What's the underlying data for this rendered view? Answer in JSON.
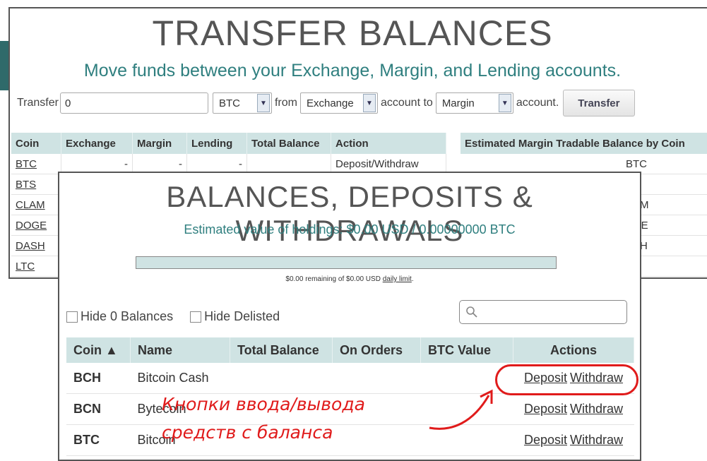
{
  "transfer": {
    "title": "TRANSFER BALANCES",
    "subtitle": "Move funds between your Exchange, Margin, and Lending accounts.",
    "transfer_label": "Transfer",
    "amount_value": "0",
    "currency_selected": "BTC",
    "from_label": "from",
    "from_selected": "Exchange",
    "to_label": "account to",
    "to_selected": "Margin",
    "account_label": "account.",
    "button_label": "Transfer"
  },
  "coin_table": {
    "headers": [
      "Coin",
      "Exchange",
      "Margin",
      "Lending",
      "Total Balance",
      "Action"
    ],
    "rows": [
      {
        "coin": "BTC",
        "exchange": "-",
        "margin": "-",
        "lending": "-",
        "total": "",
        "action": "Deposit/Withdraw"
      },
      {
        "coin": "BTS"
      },
      {
        "coin": "CLAM"
      },
      {
        "coin": "DOGE"
      },
      {
        "coin": "DASH"
      },
      {
        "coin": "LTC"
      }
    ]
  },
  "est_table": {
    "header": "Estimated Margin Tradable Balance by Coin",
    "rows": [
      "BTC",
      "",
      "AM",
      "GE",
      "SH",
      ""
    ]
  },
  "balances": {
    "title": "BALANCES, DEPOSITS & WITHDRAWALS",
    "estimate": "Estimated value of holdings: $0.00 USD / 0.00000000 BTC",
    "limit_fraction": 0,
    "limit_text_before": "$0.00 remaining of $0.00 USD",
    "limit_link": "daily limit",
    "limit_text_after": ".",
    "hide_zero_label": "Hide 0 Balances",
    "hide_delisted_label": "Hide Delisted",
    "headers": [
      "Coin ▲",
      "Name",
      "Total Balance",
      "On Orders",
      "BTC Value",
      "Actions"
    ],
    "rows": [
      {
        "code": "BCH",
        "name": "Bitcoin Cash",
        "deposit": "Deposit",
        "withdraw": "Withdraw"
      },
      {
        "code": "BCN",
        "name": "Bytecoin",
        "deposit": "Deposit",
        "withdraw": "Withdraw"
      },
      {
        "code": "BTC",
        "name": "Bitcoin",
        "deposit": "Deposit",
        "withdraw": "Withdraw"
      }
    ]
  },
  "annotation": {
    "line1": "Кнопки ввода/вывода",
    "line2": "средств с баланса",
    "color": "#e01b1b"
  },
  "colors": {
    "accent_teal": "#2f7f7f",
    "header_bg": "#cfe3e3"
  }
}
